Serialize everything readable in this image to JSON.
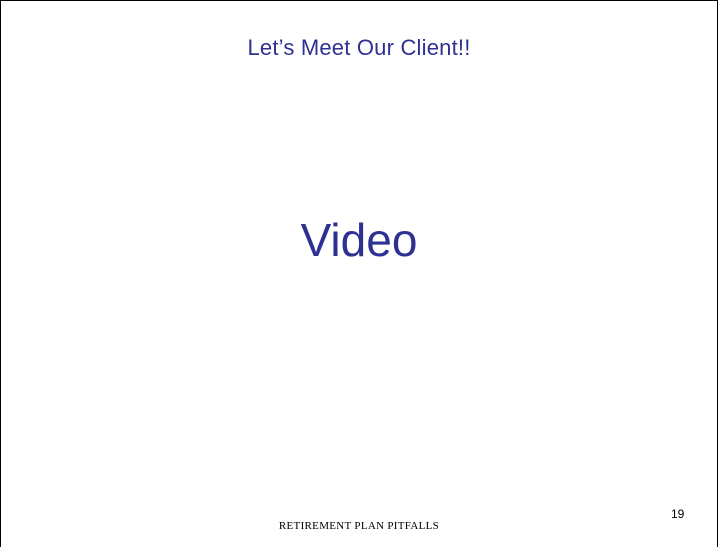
{
  "slide": {
    "title": "Let’s Meet Our Client!!",
    "body": "Video",
    "footer": "RETIREMENT PLAN PITFALLS",
    "page_number": "19"
  },
  "colors": {
    "heading": "#2e3192",
    "footer_text": "#000000",
    "background": "#ffffff"
  }
}
